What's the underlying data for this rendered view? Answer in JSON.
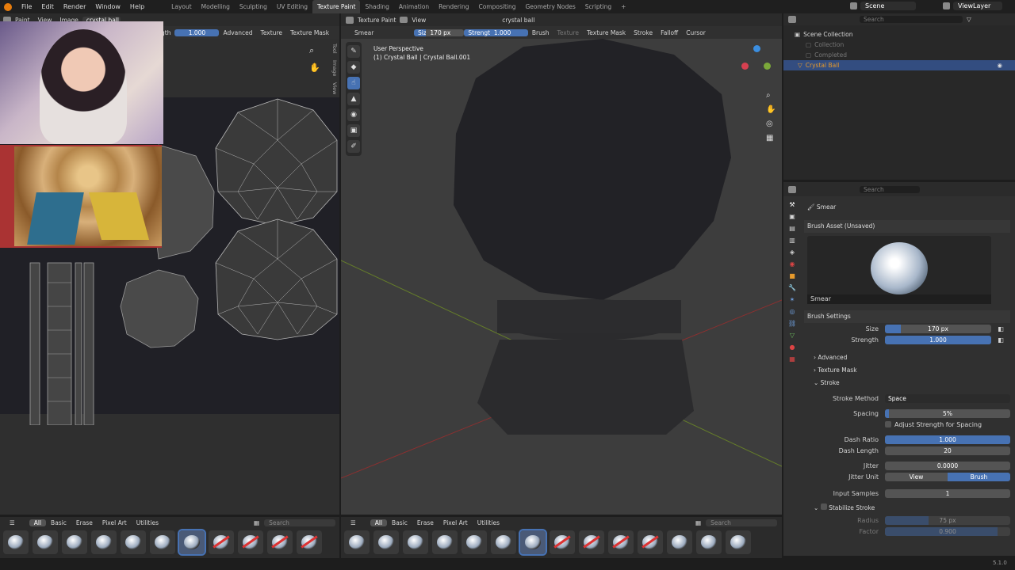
{
  "menus": [
    "File",
    "Edit",
    "Render",
    "Window",
    "Help"
  ],
  "workspaces": [
    "Layout",
    "Modelling",
    "Sculpting",
    "UV Editing",
    "Texture Paint",
    "Shading",
    "Animation",
    "Rendering",
    "Compositing",
    "Geometry Nodes",
    "Scripting",
    "+"
  ],
  "active_workspace": "Texture Paint",
  "scene": "Scene",
  "view_layer": "ViewLayer",
  "image_editor": {
    "mode": "Paint",
    "view_menu": "View",
    "image_menu": "Image",
    "image_name": "crystal ball",
    "strength_label": "gth",
    "strength_value": "1.000",
    "advanced": "Advanced",
    "texture": "Texture",
    "texture_mask": "Texture Mask",
    "side_tabs": [
      "Tool",
      "Image",
      "View"
    ]
  },
  "viewport": {
    "mode": "Texture Paint",
    "view_menu": "View",
    "object": "crystal ball",
    "brush_name": "Smear",
    "size_label": "Size",
    "size_value": "170 px",
    "strength_label": "Strength",
    "strength_value": "1.000",
    "menus": [
      "Brush",
      "Texture",
      "Texture Mask",
      "Stroke",
      "Falloff",
      "Cursor"
    ],
    "overlay_title": "User Perspective",
    "overlay_sub": "(1) Crystal Ball | Crystal Ball.001",
    "gizmo": {
      "z": "Z",
      "y": "Y",
      "x": "X"
    }
  },
  "outliner": {
    "search_placeholder": "Search",
    "root": "Scene Collection",
    "items": [
      "Collection",
      "Completed",
      "Crystal Ball"
    ]
  },
  "properties": {
    "search_placeholder": "Search",
    "brush_title": "Smear",
    "brush_asset": "Brush Asset (Unsaved)",
    "brush_preview_name": "Smear",
    "brush_settings": "Brush Settings",
    "size_label": "Size",
    "size_value": "170 px",
    "strength_label": "Strength",
    "strength_value": "1.000",
    "advanced": "Advanced",
    "texture_mask": "Texture Mask",
    "stroke": "Stroke",
    "stroke_method_label": "Stroke Method",
    "stroke_method_value": "Space",
    "spacing_label": "Spacing",
    "spacing_value": "5%",
    "adjust_strength": "Adjust Strength for Spacing",
    "dash_ratio_label": "Dash Ratio",
    "dash_ratio_value": "1.000",
    "dash_length_label": "Dash Length",
    "dash_length_value": "20",
    "jitter_label": "Jitter",
    "jitter_value": "0.0000",
    "jitter_unit_label": "Jitter Unit",
    "jitter_unit_view": "View",
    "jitter_unit_brush": "Brush",
    "input_samples_label": "Input Samples",
    "input_samples_value": "1",
    "stabilize": "Stabilize Stroke",
    "radius_label": "Radius",
    "radius_value": "75 px",
    "factor_label": "Factor",
    "factor_value": "0.900"
  },
  "asset_tabs": [
    "All",
    "Basic",
    "Erase",
    "Pixel Art",
    "Utilities"
  ],
  "asset_search": "Search",
  "version": "5.1.0",
  "colors": {
    "accent": "#4772b3",
    "bg": "#1d1d1d",
    "panel": "#303030",
    "viewport": "#3d3d3d"
  }
}
